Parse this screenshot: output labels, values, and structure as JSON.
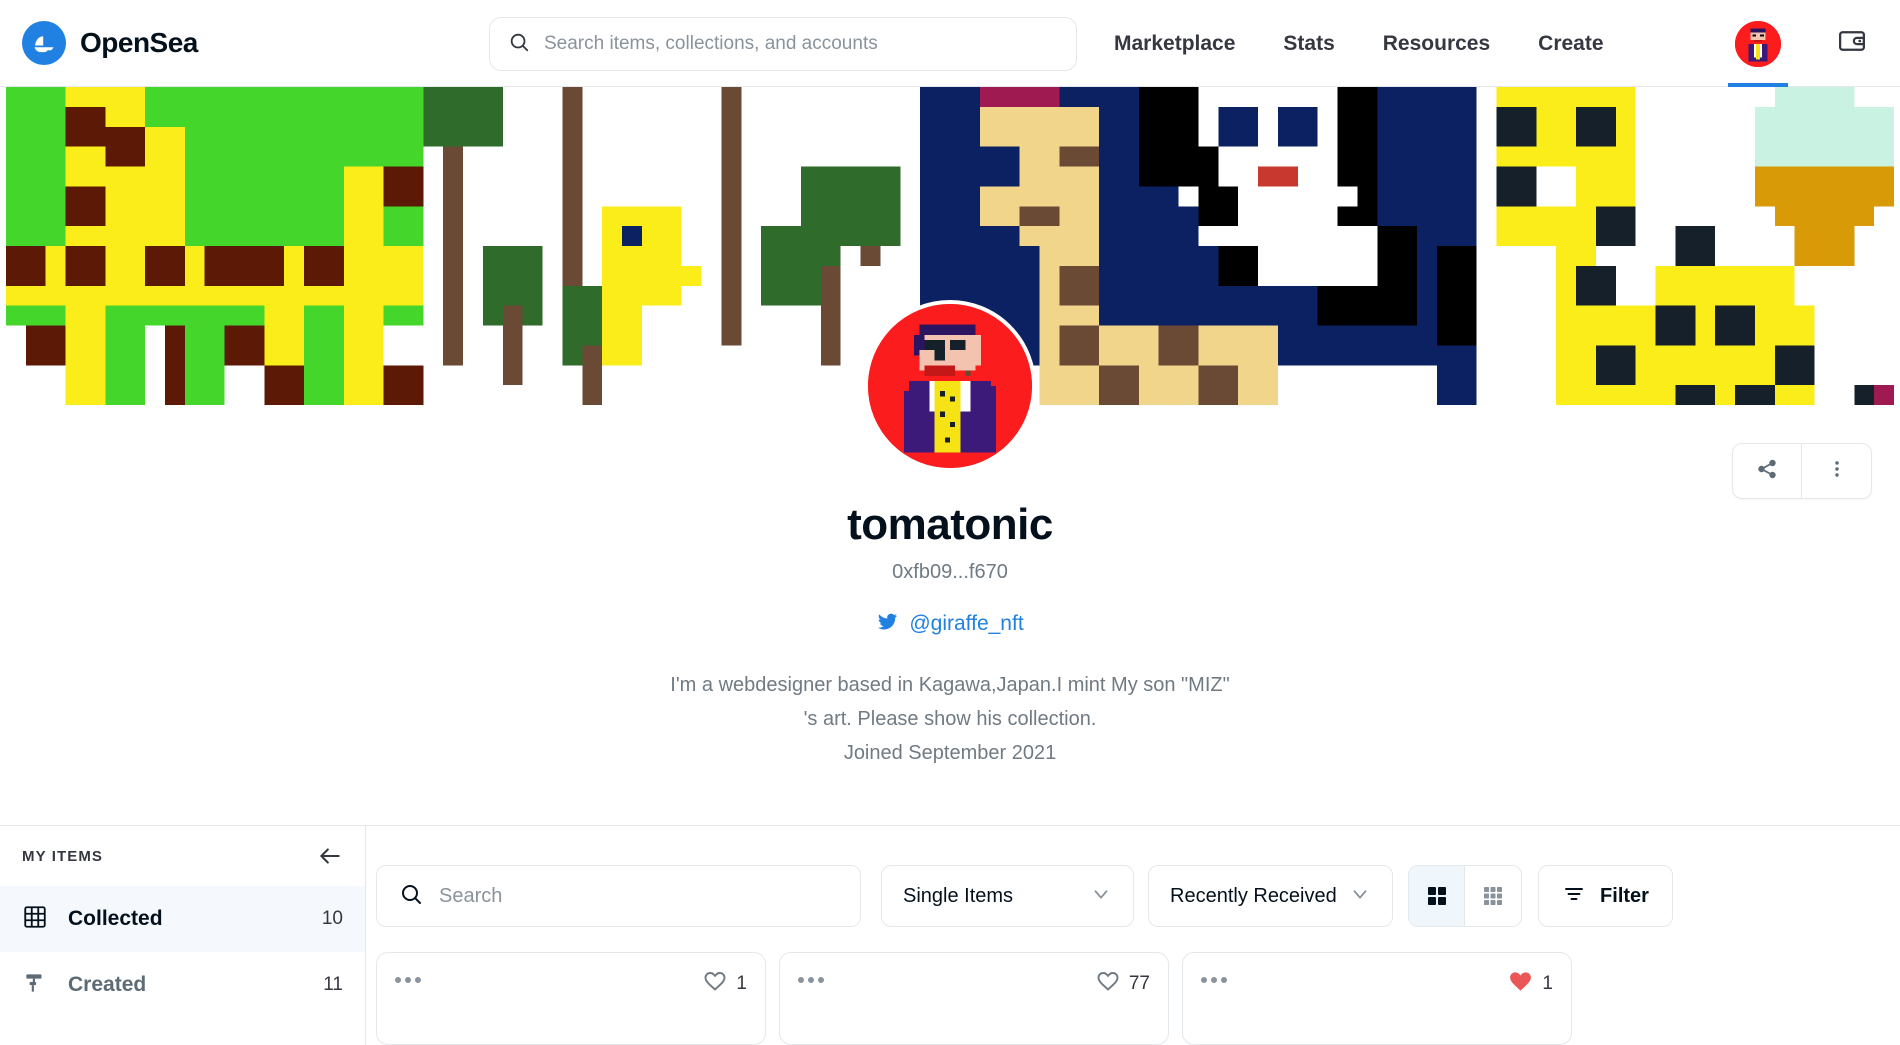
{
  "header": {
    "logo_text": "OpenSea",
    "logo_icon": "opensea-boat-icon",
    "search": {
      "placeholder": "Search items, collections, and accounts",
      "value": "",
      "icon": "search-icon"
    },
    "nav": [
      {
        "label": "Marketplace"
      },
      {
        "label": "Stats"
      },
      {
        "label": "Resources"
      },
      {
        "label": "Create"
      }
    ],
    "avatar_icon": "user-avatar",
    "wallet_icon": "wallet-icon"
  },
  "banner": {
    "icon": "pixel-art-giraffe-banner",
    "colors": {
      "green": "#45d62b",
      "yellow": "#fbed1a",
      "brown_dark": "#5c1a06",
      "navy": "#0b2162",
      "sand": "#f0d58a",
      "tree_green": "#2f6b2b",
      "trunk": "#6b4a35",
      "white": "#ffffff",
      "black": "#000000",
      "red": "#c9382f",
      "mint": "#c9f2e2",
      "gold": "#d89a06",
      "magenta": "#a01a52"
    }
  },
  "banner_actions": {
    "share_icon": "share-icon",
    "more_icon": "more-vertical-icon"
  },
  "profile": {
    "avatar_icon": "pixel-character-avatar",
    "name": "tomatonic",
    "address": "0xfb09...f670",
    "social": {
      "icon": "twitter-icon",
      "handle": "@giraffe_nft"
    },
    "bio_line_1": "I'm a webdesigner based in Kagawa,Japan.I mint My son \"MIZ\"",
    "bio_line_2": "'s art. Please show his collection.",
    "joined": "Joined September 2021"
  },
  "sidebar": {
    "title": "MY ITEMS",
    "collapse_icon": "arrow-left-icon",
    "items": [
      {
        "label": "Collected",
        "count": "10",
        "icon": "grid-icon",
        "active": true
      },
      {
        "label": "Created",
        "count": "11",
        "icon": "paint-roller-icon",
        "active": false
      }
    ]
  },
  "toolbar": {
    "search": {
      "placeholder": "Search",
      "value": "",
      "icon": "search-icon"
    },
    "type_select": {
      "value": "Single Items",
      "icon": "chevron-down-icon"
    },
    "sort_select": {
      "value": "Recently Received",
      "icon": "chevron-down-icon"
    },
    "view_toggle": {
      "large_icon": "grid-large-icon",
      "small_icon": "grid-small-icon",
      "active": "large"
    },
    "filter": {
      "label": "Filter",
      "icon": "filter-icon"
    }
  },
  "cards": [
    {
      "more_icon": "more-horizontal-icon",
      "like_icon": "heart-outline-icon",
      "likes": "1",
      "liked": false
    },
    {
      "more_icon": "more-horizontal-icon",
      "like_icon": "heart-outline-icon",
      "likes": "77",
      "liked": false
    },
    {
      "more_icon": "more-horizontal-icon",
      "like_icon": "heart-filled-icon",
      "likes": "1",
      "liked": true
    }
  ],
  "colors": {
    "brand_blue": "#2081e2",
    "heart_red": "#eb5757",
    "text_dark": "#04111d",
    "text_muted": "#707a83",
    "border": "#e5e8eb"
  }
}
